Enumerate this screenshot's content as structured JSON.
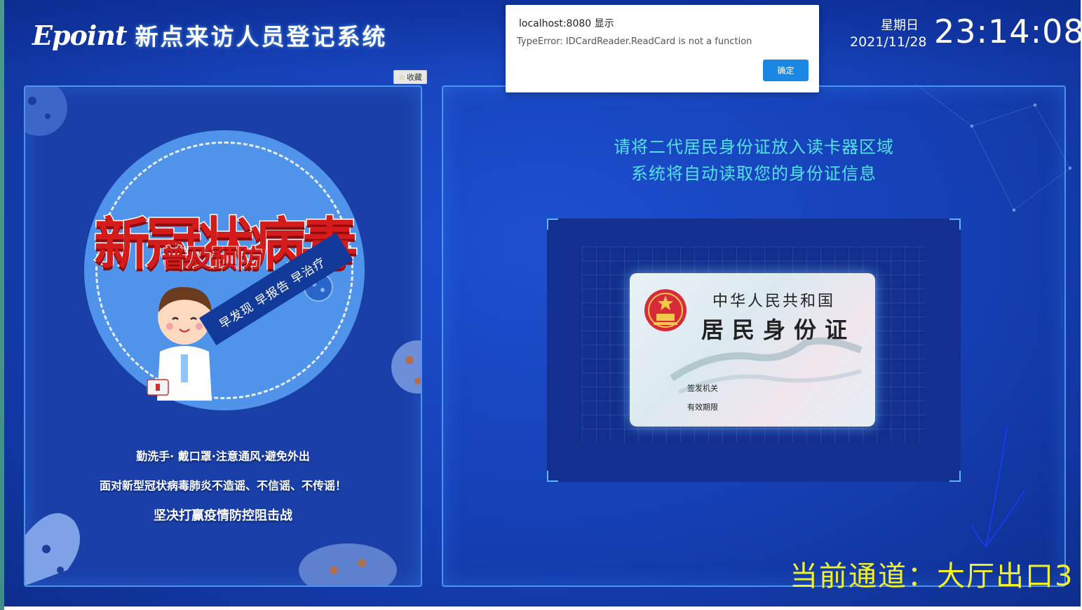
{
  "header": {
    "logo_mark": "Epoint",
    "system_title": "新点来访人员登记系统",
    "weekday": "星期日",
    "date": "2021/11/28",
    "time": "23:14:08"
  },
  "favorite_button": {
    "icon": "star-icon",
    "label": "收藏"
  },
  "poster": {
    "title_large": "新冠状病毒",
    "title_small": "普及预防",
    "ribbon": "早发现 早报告 早治疗",
    "slogans": [
      "勤洗手· 戴口罩·注意通风·避免外出",
      "面对新型冠状病毒肺炎不造谣、不信谣、不传谣！",
      "坚决打赢疫情防控阻击战"
    ]
  },
  "reader": {
    "instruction_line1": "请将二代居民身份证放入读卡器区域",
    "instruction_line2": "系统将自动读取您的身份证信息",
    "card": {
      "country": "中华人民共和国",
      "card_name": "居民身份证",
      "issuer_label": "签发机关",
      "validity_label": "有效期限"
    }
  },
  "channel_text": "当前通道：大厅出口3",
  "dialog": {
    "title": "localhost:8080 显示",
    "message": "TypeError: IDCardReader.ReadCard is not a function",
    "ok_label": "确定"
  },
  "colors": {
    "background": "#1540b5",
    "panel_border": "#5aaaff",
    "instruction": "#56e0ea",
    "channel": "#f1f02d",
    "dialog_button": "#1a88e2"
  }
}
